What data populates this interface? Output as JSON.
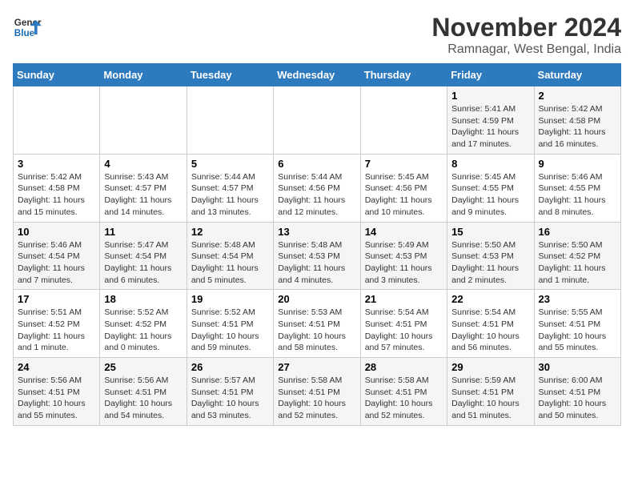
{
  "header": {
    "logo_general": "General",
    "logo_blue": "Blue",
    "month_title": "November 2024",
    "location": "Ramnagar, West Bengal, India"
  },
  "weekdays": [
    "Sunday",
    "Monday",
    "Tuesday",
    "Wednesday",
    "Thursday",
    "Friday",
    "Saturday"
  ],
  "rows": [
    [
      {
        "day": "",
        "content": ""
      },
      {
        "day": "",
        "content": ""
      },
      {
        "day": "",
        "content": ""
      },
      {
        "day": "",
        "content": ""
      },
      {
        "day": "",
        "content": ""
      },
      {
        "day": "1",
        "content": "Sunrise: 5:41 AM\nSunset: 4:59 PM\nDaylight: 11 hours and 17 minutes."
      },
      {
        "day": "2",
        "content": "Sunrise: 5:42 AM\nSunset: 4:58 PM\nDaylight: 11 hours and 16 minutes."
      }
    ],
    [
      {
        "day": "3",
        "content": "Sunrise: 5:42 AM\nSunset: 4:58 PM\nDaylight: 11 hours and 15 minutes."
      },
      {
        "day": "4",
        "content": "Sunrise: 5:43 AM\nSunset: 4:57 PM\nDaylight: 11 hours and 14 minutes."
      },
      {
        "day": "5",
        "content": "Sunrise: 5:44 AM\nSunset: 4:57 PM\nDaylight: 11 hours and 13 minutes."
      },
      {
        "day": "6",
        "content": "Sunrise: 5:44 AM\nSunset: 4:56 PM\nDaylight: 11 hours and 12 minutes."
      },
      {
        "day": "7",
        "content": "Sunrise: 5:45 AM\nSunset: 4:56 PM\nDaylight: 11 hours and 10 minutes."
      },
      {
        "day": "8",
        "content": "Sunrise: 5:45 AM\nSunset: 4:55 PM\nDaylight: 11 hours and 9 minutes."
      },
      {
        "day": "9",
        "content": "Sunrise: 5:46 AM\nSunset: 4:55 PM\nDaylight: 11 hours and 8 minutes."
      }
    ],
    [
      {
        "day": "10",
        "content": "Sunrise: 5:46 AM\nSunset: 4:54 PM\nDaylight: 11 hours and 7 minutes."
      },
      {
        "day": "11",
        "content": "Sunrise: 5:47 AM\nSunset: 4:54 PM\nDaylight: 11 hours and 6 minutes."
      },
      {
        "day": "12",
        "content": "Sunrise: 5:48 AM\nSunset: 4:54 PM\nDaylight: 11 hours and 5 minutes."
      },
      {
        "day": "13",
        "content": "Sunrise: 5:48 AM\nSunset: 4:53 PM\nDaylight: 11 hours and 4 minutes."
      },
      {
        "day": "14",
        "content": "Sunrise: 5:49 AM\nSunset: 4:53 PM\nDaylight: 11 hours and 3 minutes."
      },
      {
        "day": "15",
        "content": "Sunrise: 5:50 AM\nSunset: 4:53 PM\nDaylight: 11 hours and 2 minutes."
      },
      {
        "day": "16",
        "content": "Sunrise: 5:50 AM\nSunset: 4:52 PM\nDaylight: 11 hours and 1 minute."
      }
    ],
    [
      {
        "day": "17",
        "content": "Sunrise: 5:51 AM\nSunset: 4:52 PM\nDaylight: 11 hours and 1 minute."
      },
      {
        "day": "18",
        "content": "Sunrise: 5:52 AM\nSunset: 4:52 PM\nDaylight: 11 hours and 0 minutes."
      },
      {
        "day": "19",
        "content": "Sunrise: 5:52 AM\nSunset: 4:51 PM\nDaylight: 10 hours and 59 minutes."
      },
      {
        "day": "20",
        "content": "Sunrise: 5:53 AM\nSunset: 4:51 PM\nDaylight: 10 hours and 58 minutes."
      },
      {
        "day": "21",
        "content": "Sunrise: 5:54 AM\nSunset: 4:51 PM\nDaylight: 10 hours and 57 minutes."
      },
      {
        "day": "22",
        "content": "Sunrise: 5:54 AM\nSunset: 4:51 PM\nDaylight: 10 hours and 56 minutes."
      },
      {
        "day": "23",
        "content": "Sunrise: 5:55 AM\nSunset: 4:51 PM\nDaylight: 10 hours and 55 minutes."
      }
    ],
    [
      {
        "day": "24",
        "content": "Sunrise: 5:56 AM\nSunset: 4:51 PM\nDaylight: 10 hours and 55 minutes."
      },
      {
        "day": "25",
        "content": "Sunrise: 5:56 AM\nSunset: 4:51 PM\nDaylight: 10 hours and 54 minutes."
      },
      {
        "day": "26",
        "content": "Sunrise: 5:57 AM\nSunset: 4:51 PM\nDaylight: 10 hours and 53 minutes."
      },
      {
        "day": "27",
        "content": "Sunrise: 5:58 AM\nSunset: 4:51 PM\nDaylight: 10 hours and 52 minutes."
      },
      {
        "day": "28",
        "content": "Sunrise: 5:58 AM\nSunset: 4:51 PM\nDaylight: 10 hours and 52 minutes."
      },
      {
        "day": "29",
        "content": "Sunrise: 5:59 AM\nSunset: 4:51 PM\nDaylight: 10 hours and 51 minutes."
      },
      {
        "day": "30",
        "content": "Sunrise: 6:00 AM\nSunset: 4:51 PM\nDaylight: 10 hours and 50 minutes."
      }
    ]
  ]
}
